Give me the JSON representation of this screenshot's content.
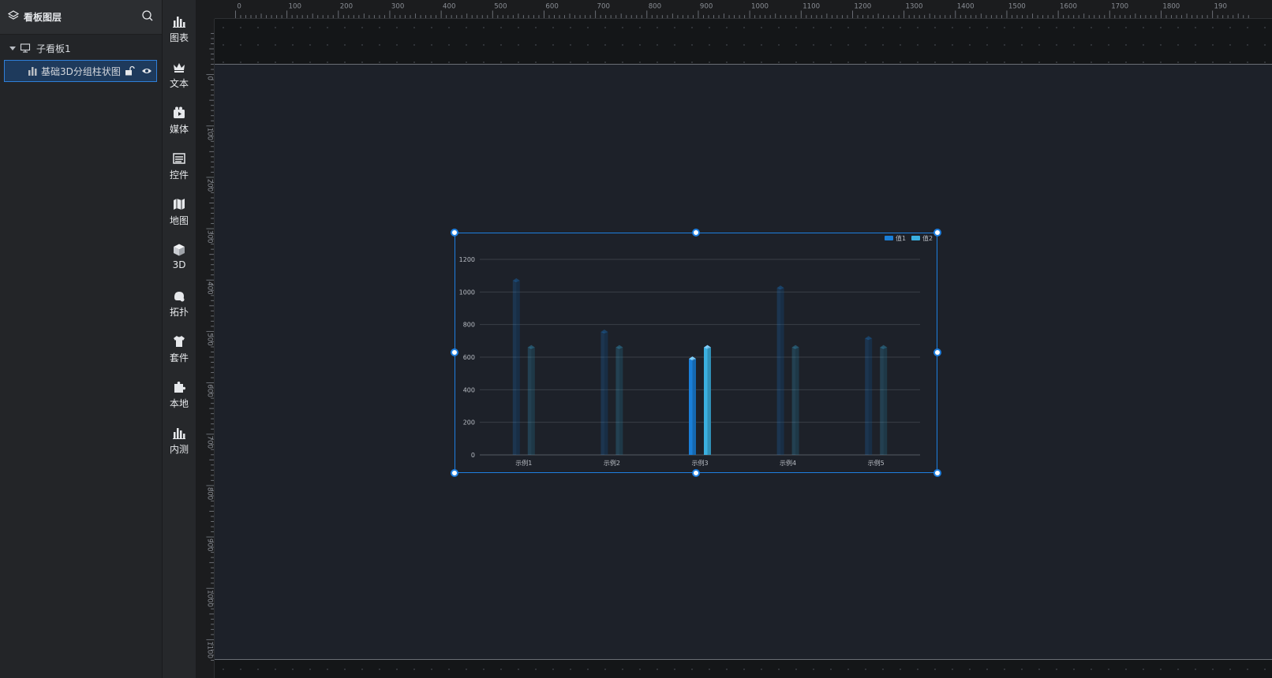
{
  "layers_panel": {
    "title": "看板图层",
    "tree": {
      "parent_label": "子看板1",
      "child_label": "基础3D分组柱状图"
    }
  },
  "categories": [
    {
      "label": "图表",
      "icon": "bar-chart-icon"
    },
    {
      "label": "文本",
      "icon": "crown-icon"
    },
    {
      "label": "媒体",
      "icon": "media-icon"
    },
    {
      "label": "控件",
      "icon": "controls-icon"
    },
    {
      "label": "地图",
      "icon": "map-icon"
    },
    {
      "label": "3D",
      "icon": "cube-icon"
    },
    {
      "label": "拓扑",
      "icon": "topology-icon"
    },
    {
      "label": "套件",
      "icon": "shirt-icon"
    },
    {
      "label": "本地",
      "icon": "puzzle-icon"
    },
    {
      "label": "内测",
      "icon": "bar-chart-icon"
    }
  ],
  "rulers": {
    "horizontal_labels": [
      "0",
      "100",
      "200",
      "300",
      "400",
      "500",
      "600",
      "700",
      "800",
      "900",
      "1000",
      "1100",
      "1200",
      "1300",
      "1400",
      "1500",
      "1600",
      "1700",
      "1800",
      "190"
    ],
    "vertical_labels": [
      "0",
      "100",
      "200",
      "300",
      "400",
      "500",
      "600",
      "700",
      "800",
      "900",
      "1000",
      "1100"
    ]
  },
  "colors": {
    "selection": "#1e7fe0",
    "series1": "#1a7fd8",
    "series2": "#3bb0e0"
  },
  "chart_data": {
    "type": "bar",
    "categories": [
      "示例1",
      "示例2",
      "示例3",
      "示例4",
      "示例5"
    ],
    "series": [
      {
        "name": "值1",
        "values": [
          1070,
          755,
          590,
          1025,
          715
        ]
      },
      {
        "name": "值2",
        "values": [
          660,
          660,
          660,
          660,
          660
        ]
      }
    ],
    "highlighted_category_index": 2,
    "yticks": [
      "0",
      "200",
      "400",
      "600",
      "800",
      "1000",
      "1200"
    ],
    "ylim": [
      0,
      1200
    ],
    "grid": true,
    "legend_position": "top-right"
  }
}
